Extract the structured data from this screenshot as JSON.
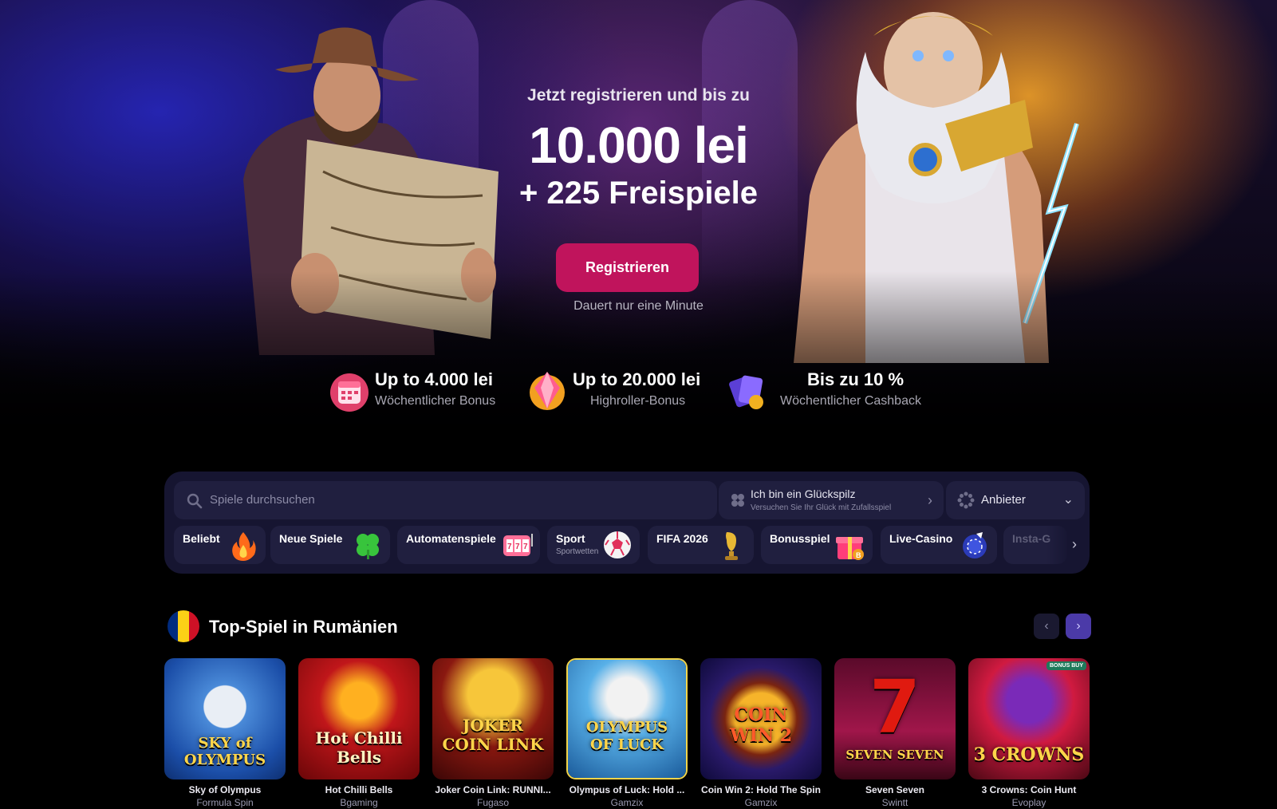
{
  "hero": {
    "subtitle": "Jetzt registrieren und bis zu",
    "amount": "10.000 lei",
    "spins": "+ 225 Freispiele",
    "register_label": "Registrieren",
    "note": "Dauert nur eine Minute"
  },
  "bonuses": [
    {
      "title": "Up to 4.000 lei",
      "subtitle": "Wöchentlicher Bonus",
      "icon": "calendar-icon"
    },
    {
      "title": "Up to 20.000 lei",
      "subtitle": "Highroller-Bonus",
      "icon": "diamond-icon"
    },
    {
      "title": "Bis zu 10 %",
      "subtitle": "Wöchentlicher Cashback",
      "icon": "cards-icon"
    }
  ],
  "filters": {
    "search_placeholder": "Spiele durchsuchen",
    "lucky_title": "Ich bin ein Glückspilz",
    "lucky_subtitle": "Versuchen Sie Ihr Glück mit Zufallsspiel",
    "provider_label": "Anbieter"
  },
  "categories": [
    {
      "label": "Beliebt",
      "sub": "",
      "icon": "fire-icon"
    },
    {
      "label": "Neue Spiele",
      "sub": "",
      "icon": "clover-icon"
    },
    {
      "label": "Automatenspiele",
      "sub": "",
      "icon": "slot-machine-icon"
    },
    {
      "label": "Sport",
      "sub": "Sportwetten",
      "icon": "soccer-ball-icon"
    },
    {
      "label": "FIFA 2026",
      "sub": "",
      "icon": "trophy-icon"
    },
    {
      "label": "Bonusspiel",
      "sub": "",
      "icon": "gift-icon"
    },
    {
      "label": "Live-Casino",
      "sub": "",
      "icon": "poker-chip-icon"
    },
    {
      "label": "Insta-G",
      "sub": "",
      "icon": "instant-icon"
    }
  ],
  "top_games": {
    "title": "Top-Spiel in Rumänien",
    "flag_colors": [
      "#002b7f",
      "#fcd116",
      "#ce1126"
    ],
    "games": [
      {
        "name": "Sky of Olympus",
        "provider": "Formula Spin",
        "logo": "SKY of OLYMPUS",
        "badge": ""
      },
      {
        "name": "Hot Chilli Bells",
        "provider": "Bgaming",
        "logo": "Hot Chilli Bells",
        "badge": ""
      },
      {
        "name": "Joker Coin Link: RUNNI...",
        "provider": "Fugaso",
        "logo": "JOKER COIN LINK",
        "badge": ""
      },
      {
        "name": "Olympus of Luck: Hold ...",
        "provider": "Gamzix",
        "logo": "OLYMPUS OF LUCK",
        "badge": ""
      },
      {
        "name": "Coin Win 2: Hold The Spin",
        "provider": "Gamzix",
        "logo": "COIN WIN 2",
        "badge": ""
      },
      {
        "name": "Seven Seven",
        "provider": "Swintt",
        "logo": "SEVEN SEVEN",
        "badge": ""
      },
      {
        "name": "3 Crowns: Coin Hunt",
        "provider": "Evoplay",
        "logo": "3 CROWNS",
        "badge": "BONUS BUY"
      }
    ]
  },
  "colors": {
    "accent": "#c0145c",
    "panel": "#161531",
    "field": "#201f3f",
    "nav_active": "#4b3aa8"
  }
}
